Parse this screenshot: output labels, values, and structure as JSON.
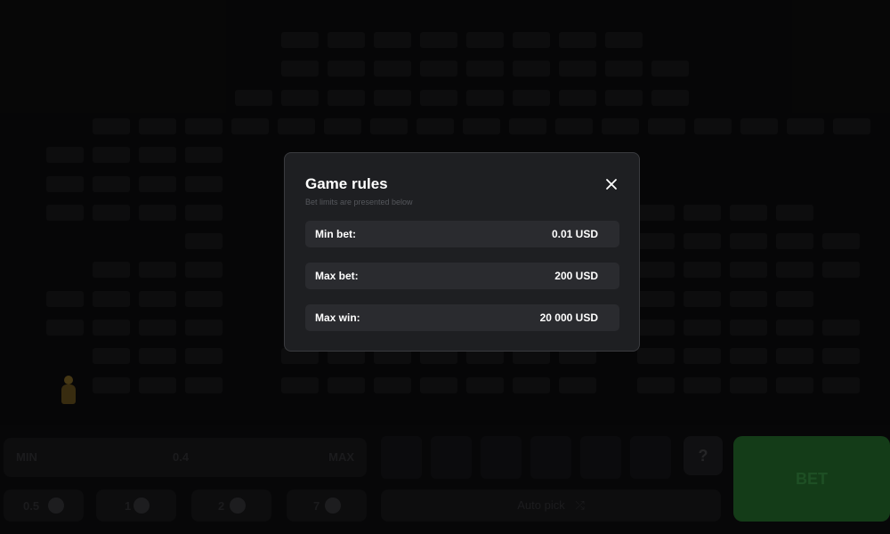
{
  "modal": {
    "title": "Game rules",
    "subtitle": "Bet limits are presented below",
    "rows": [
      {
        "label": "Min bet:",
        "value": "0.01 USD"
      },
      {
        "label": "Max bet:",
        "value": "200 USD"
      },
      {
        "label": "Max win:",
        "value": "20 000 USD"
      }
    ]
  },
  "controls": {
    "bet_min": "MIN",
    "bet_value": "0.4",
    "bet_max": "MAX",
    "chips": [
      "0.5",
      "1",
      "2",
      "7"
    ],
    "help_label": "?",
    "auto_pick_label": "Auto pick",
    "bet_label": "BET"
  },
  "colors": {
    "modal_bg": "#1e1f22",
    "row_bg": "#2a2b2f",
    "bet_button": "#1f5c26"
  },
  "icons": {
    "close": "close-icon",
    "coin": "coin-icon",
    "auto_pick": "shuffle-icon"
  }
}
